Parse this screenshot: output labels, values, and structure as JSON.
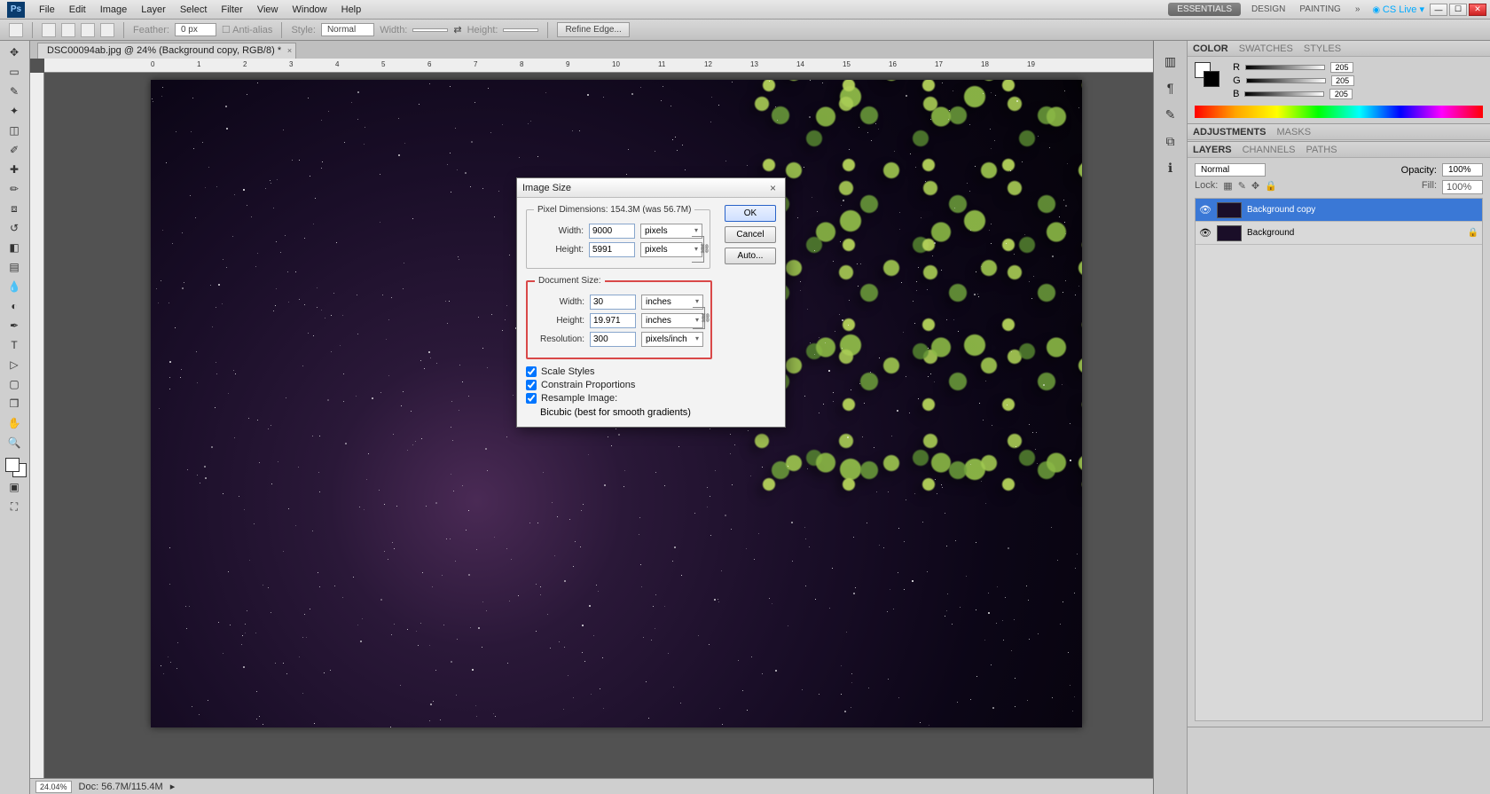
{
  "menu": {
    "items": [
      "File",
      "Edit",
      "Image",
      "Layer",
      "Select",
      "Filter",
      "View",
      "Window",
      "Help"
    ],
    "workspace_essentials": "ESSENTIALS",
    "workspace_design": "DESIGN",
    "workspace_painting": "PAINTING",
    "cslive": "CS Live ▾"
  },
  "options": {
    "style_label": "Style:",
    "style_value": "Normal",
    "refine": "Refine Edge...",
    "width_label": "Width:",
    "height_label": "Height:"
  },
  "tab": {
    "title": "DSC00094ab.jpg @ 24% (Background copy, RGB/8) *"
  },
  "ruler": {
    "marks": [
      "0",
      "1",
      "2",
      "3",
      "4",
      "5",
      "6",
      "7",
      "8",
      "9",
      "10",
      "11",
      "12",
      "13",
      "14",
      "15",
      "16",
      "17",
      "18",
      "19"
    ]
  },
  "status": {
    "zoom": "24.04%",
    "docinfo": "Doc: 56.7M/115.4M"
  },
  "panels": {
    "color": {
      "tab1": "COLOR",
      "tab2": "SWATCHES",
      "tab3": "STYLES",
      "r": "205",
      "g": "205",
      "b": "205"
    },
    "adjust": {
      "tab1": "ADJUSTMENTS",
      "tab2": "MASKS"
    },
    "layers": {
      "tab1": "LAYERS",
      "tab2": "CHANNELS",
      "tab3": "PATHS",
      "blend": "Normal",
      "opacity_label": "Opacity:",
      "opacity": "100%",
      "fill_label": "Fill:",
      "fill": "100%",
      "lock_label": "Lock:",
      "items": [
        {
          "name": "Background copy",
          "selected": true,
          "lock": false
        },
        {
          "name": "Background",
          "selected": false,
          "lock": true
        }
      ]
    }
  },
  "dialog": {
    "title": "Image Size",
    "pixel_legend": "Pixel Dimensions: 154.3M (was 56.7M)",
    "doc_legend": "Document Size:",
    "width_label": "Width:",
    "height_label": "Height:",
    "resolution_label": "Resolution:",
    "px_width": "9000",
    "px_height": "5991",
    "px_unit": "pixels",
    "doc_width": "30",
    "doc_height": "19.971",
    "doc_unit": "inches",
    "resolution": "300",
    "res_unit": "pixels/inch",
    "scale_styles": "Scale Styles",
    "constrain": "Constrain Proportions",
    "resample": "Resample Image:",
    "interp": "Bicubic (best for smooth gradients)",
    "ok": "OK",
    "cancel": "Cancel",
    "auto": "Auto..."
  },
  "colors": {
    "accent": "#3a78d6",
    "highlight": "#d94848"
  }
}
